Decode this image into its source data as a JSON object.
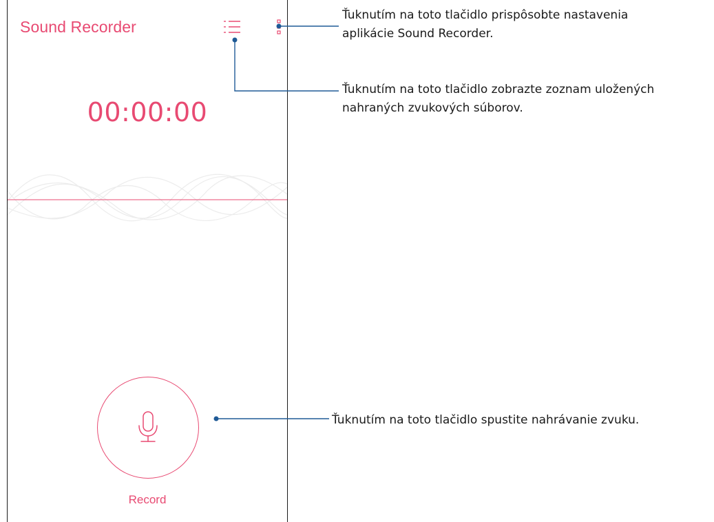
{
  "app": {
    "title": "Sound Recorder",
    "accent_color": "#e84a72"
  },
  "toolbar": {
    "list_icon": "list-icon",
    "menu_icon": "more-vert-icon"
  },
  "recorder": {
    "timer": "00:00:00",
    "record_label": "Record",
    "record_icon": "microphone-icon"
  },
  "callouts": {
    "settings_line1": "Ťuknutím na toto tlačidlo prispôsobte nastavenia",
    "settings_line2": "aplikácie Sound Recorder.",
    "list_line1": "Ťuknutím na toto tlačidlo zobrazte zoznam uložených",
    "list_line2": "nahraných zvukových súborov.",
    "record_line1": "Ťuknutím na toto tlačidlo spustite nahrávanie zvuku.",
    "line_color": "#1f5a96"
  }
}
